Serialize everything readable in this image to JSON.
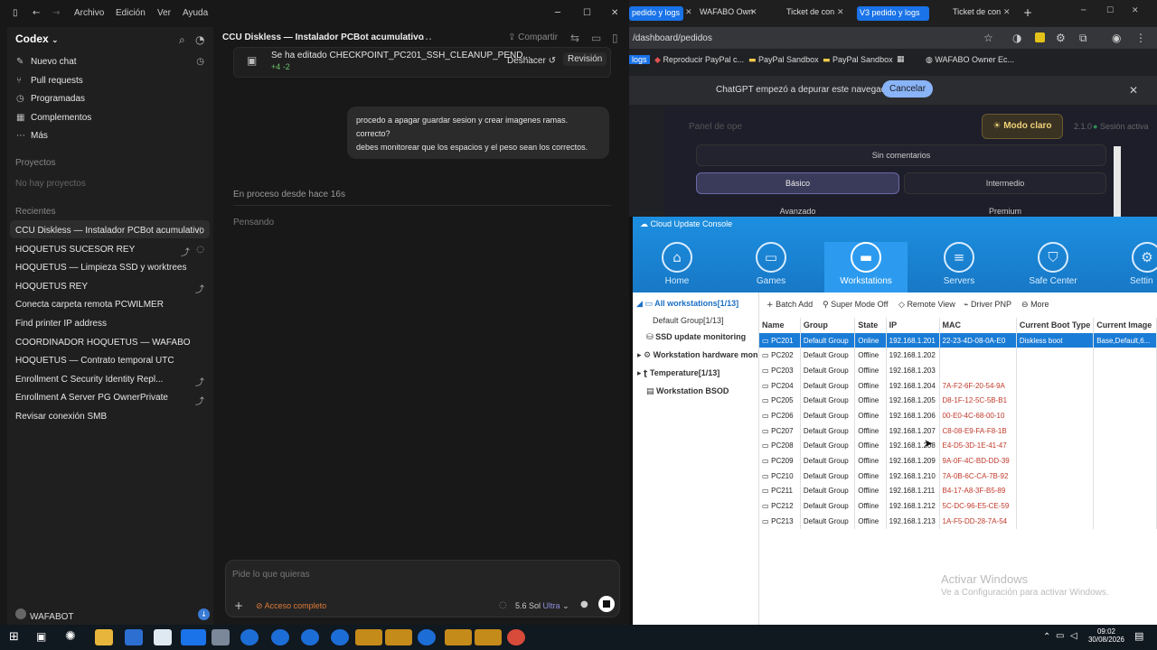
{
  "menubar": {
    "items": [
      "Archivo",
      "Edición",
      "Ver",
      "Ayuda"
    ]
  },
  "sidebar": {
    "app_name": "Codex",
    "nav": [
      {
        "label": "Nuevo chat",
        "icon": "compose-icon"
      },
      {
        "label": "Pull requests",
        "icon": "branch-icon"
      },
      {
        "label": "Programadas",
        "icon": "clock-icon"
      },
      {
        "label": "Complementos",
        "icon": "plugin-icon"
      },
      {
        "label": "Más",
        "icon": "dots-icon"
      }
    ],
    "projects_title": "Proyectos",
    "projects_empty": "No hay proyectos",
    "recent_title": "Recientes",
    "recent": [
      "CCU Diskless — Instalador PCBot acumulativo",
      "HOQUETUS SUCESOR REY",
      "HOQUETUS — Limpieza SSD y worktrees",
      "HOQUETUS REY",
      "Conecta carpeta remota PCWILMER",
      "Find printer IP address",
      "COORDINADOR HOQUETUS — WAFABO",
      "HOQUETUS — Contrato temporal UTC",
      "Enrollment C Security Identity Repl...",
      "Enrollment A Server PG OwnerPrivate",
      "Revisar conexión SMB"
    ],
    "user": "WAFABOT"
  },
  "chat": {
    "title": "CCU Diskless — Instalador PCBot acumulativo",
    "share": "Compartir",
    "edit_title": "Se ha editado CHECKPOINT_PC201_SSH_CLEANUP_PEND...",
    "edit_diff": "+4 -2",
    "undo": "Deshacer",
    "review": "Revisión",
    "user_message": [
      "procedo a apagar guardar sesion y crear imagenes ramas.",
      "correcto?",
      "debes monitorear que los espacios y el peso sean los correctos."
    ],
    "status": "En proceso desde hace 16s",
    "thinking": "Pensando",
    "input_placeholder": "Pide lo que quieras",
    "access": "Acceso completo",
    "model": "5.6 Sol",
    "model_mode": "Ultra"
  },
  "browser": {
    "tabs": [
      "pedido y logs",
      "WAFABO Own",
      "Ticket de con",
      "V3 pedido y logs",
      "Ticket de con"
    ],
    "url": "/dashboard/pedidos",
    "bookmarks": [
      "logs",
      "Reproducir PayPal c...",
      "PayPal Sandbox",
      "PayPal Sandbox",
      "WAFABO Owner Ec..."
    ],
    "debug_msg": "ChatGPT empezó a depurar este navegador",
    "cancel": "Cancelar",
    "panel_label": "Panel de ope",
    "mode_button": "Modo claro",
    "version": "2.1.0",
    "session": "Sesión activa",
    "no_comments": "Sin comentarios",
    "levels": [
      "Básico",
      "Intermedio",
      "Avanzado",
      "Premium"
    ]
  },
  "ccu": {
    "title": "Cloud Update Console",
    "nav": [
      "Home",
      "Games",
      "Workstations",
      "Servers",
      "Safe Center",
      "Settin"
    ],
    "tree": [
      {
        "label": "All workstations[1/13]"
      },
      {
        "label": "Default Group[1/13]"
      },
      {
        "label": "SSD update monitoring"
      },
      {
        "label": "Workstation hardware mon"
      },
      {
        "label": "Temperature[1/13]"
      },
      {
        "label": "Workstation BSOD"
      }
    ],
    "toolbar": [
      "Batch Add",
      "Super Mode Off",
      "Remote View",
      "Driver PNP",
      "More"
    ],
    "columns": [
      "Name",
      "Group",
      "State",
      "IP",
      "MAC",
      "Current Boot Type",
      "Current Image"
    ],
    "rows": [
      [
        "PC201",
        "Default Group",
        "Online",
        "192.168.1.201",
        "22-23-4D-08-0A-E0",
        "Diskless boot",
        "Base,Default,6..."
      ],
      [
        "PC202",
        "Default Group",
        "Offline",
        "192.168.1.202",
        "",
        "",
        ""
      ],
      [
        "PC203",
        "Default Group",
        "Offline",
        "192.168.1.203",
        "",
        "",
        ""
      ],
      [
        "PC204",
        "Default Group",
        "Offline",
        "192.168.1.204",
        "7A-F2-6F-20-54-9A",
        "",
        ""
      ],
      [
        "PC205",
        "Default Group",
        "Offline",
        "192.168.1.205",
        "D8-1F-12-5C-5B-B1",
        "",
        ""
      ],
      [
        "PC206",
        "Default Group",
        "Offline",
        "192.168.1.206",
        "00-E0-4C-68-00-10",
        "",
        ""
      ],
      [
        "PC207",
        "Default Group",
        "Offline",
        "192.168.1.207",
        "C8-08-E9-FA-F8-1B",
        "",
        ""
      ],
      [
        "PC208",
        "Default Group",
        "Offline",
        "192.168.1.208",
        "E4-D5-3D-1E-41-47",
        "",
        ""
      ],
      [
        "PC209",
        "Default Group",
        "Offline",
        "192.168.1.209",
        "9A-0F-4C-BD-DD-39",
        "",
        ""
      ],
      [
        "PC210",
        "Default Group",
        "Offline",
        "192.168.1.210",
        "7A-0B-6C-CA-7B-92",
        "",
        ""
      ],
      [
        "PC211",
        "Default Group",
        "Offline",
        "192.168.1.211",
        "B4-17-A8-3F-B5-89",
        "",
        ""
      ],
      [
        "PC212",
        "Default Group",
        "Offline",
        "192.168.1.212",
        "5C-DC-96-E5-CE-59",
        "",
        ""
      ],
      [
        "PC213",
        "Default Group",
        "Offline",
        "192.168.1.213",
        "1A-F5-DD-28-7A-54",
        "",
        ""
      ]
    ],
    "watermark_title": "Activar Windows",
    "watermark_sub": "Ve a Configuración para activar Windows."
  },
  "taskbar": {
    "time": "09:02",
    "date": "30/08/2026"
  }
}
